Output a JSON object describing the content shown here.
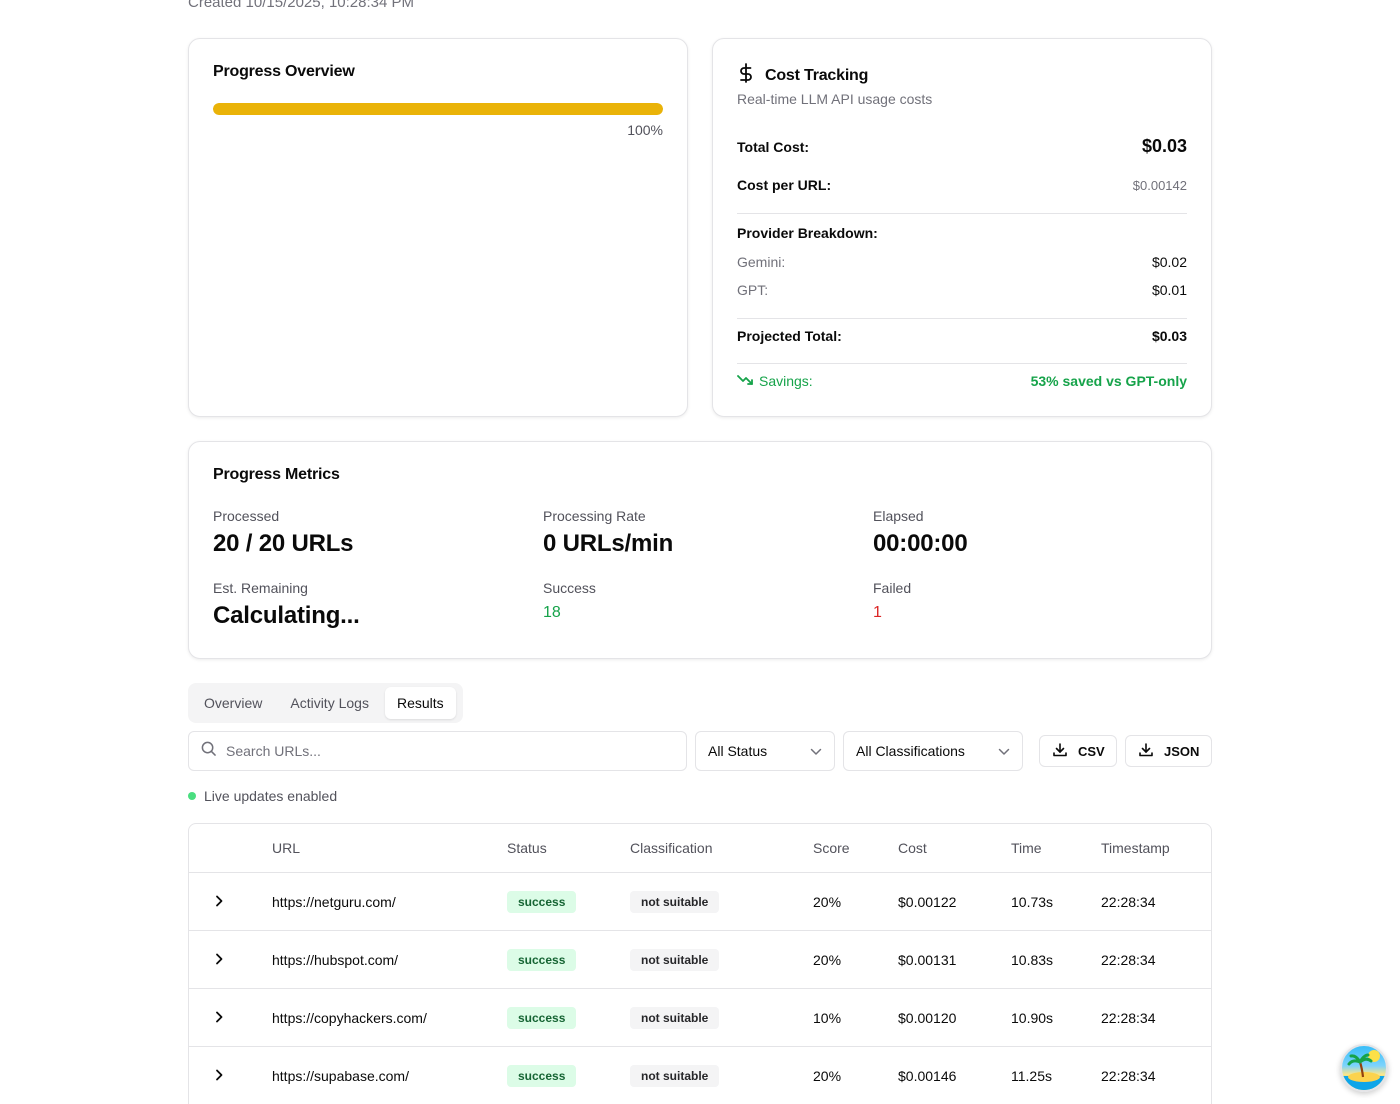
{
  "header": {
    "created": "Created 10/15/2025, 10:28:34 PM"
  },
  "progress_overview": {
    "title": "Progress Overview",
    "percent_label": "100%",
    "progress_fraction": 1.0,
    "bar_color": "#eab308"
  },
  "cost_tracking": {
    "title": "Cost Tracking",
    "subtitle": "Real-time LLM API usage costs",
    "total_cost_label": "Total Cost:",
    "total_cost_value": "$0.03",
    "cost_per_url_label": "Cost per URL:",
    "cost_per_url_value": "$0.00142",
    "provider_breakdown_label": "Provider Breakdown:",
    "providers": [
      {
        "name": "Gemini:",
        "value": "$0.02"
      },
      {
        "name": "GPT:",
        "value": "$0.01"
      }
    ],
    "projected_total_label": "Projected Total:",
    "projected_total_value": "$0.03",
    "savings_label": "Savings:",
    "savings_value": "53% saved vs GPT-only",
    "savings_color": "#16a34a"
  },
  "progress_metrics": {
    "title": "Progress Metrics",
    "processed_label": "Processed",
    "processed_value": "20 / 20 URLs",
    "rate_label": "Processing Rate",
    "rate_value": "0 URLs/min",
    "elapsed_label": "Elapsed",
    "elapsed_value": "00:00:00",
    "remaining_label": "Est. Remaining",
    "remaining_value": "Calculating...",
    "success_label": "Success",
    "success_value": "18",
    "failed_label": "Failed",
    "failed_value": "1"
  },
  "tabs": [
    {
      "label": "Overview",
      "active": false
    },
    {
      "label": "Activity Logs",
      "active": false
    },
    {
      "label": "Results",
      "active": true
    }
  ],
  "toolbar": {
    "search_placeholder": "Search URLs...",
    "status_filter": "All Status",
    "classification_filter": "All Classifications",
    "csv_label": "CSV",
    "json_label": "JSON"
  },
  "live_updates": {
    "label": "Live updates enabled",
    "dot_color": "#4ade80"
  },
  "table": {
    "columns": [
      "URL",
      "Status",
      "Classification",
      "Score",
      "Cost",
      "Time",
      "Timestamp"
    ],
    "rows": [
      {
        "url": "https://netguru.com/",
        "status": "success",
        "classification": "not suitable",
        "score": "20%",
        "cost": "$0.00122",
        "time": "10.73s",
        "timestamp": "22:28:34"
      },
      {
        "url": "https://hubspot.com/",
        "status": "success",
        "classification": "not suitable",
        "score": "20%",
        "cost": "$0.00131",
        "time": "10.83s",
        "timestamp": "22:28:34"
      },
      {
        "url": "https://copyhackers.com/",
        "status": "success",
        "classification": "not suitable",
        "score": "10%",
        "cost": "$0.00120",
        "time": "10.90s",
        "timestamp": "22:28:34"
      },
      {
        "url": "https://supabase.com/",
        "status": "success",
        "classification": "not suitable",
        "score": "20%",
        "cost": "$0.00146",
        "time": "11.25s",
        "timestamp": "22:28:34"
      }
    ]
  }
}
